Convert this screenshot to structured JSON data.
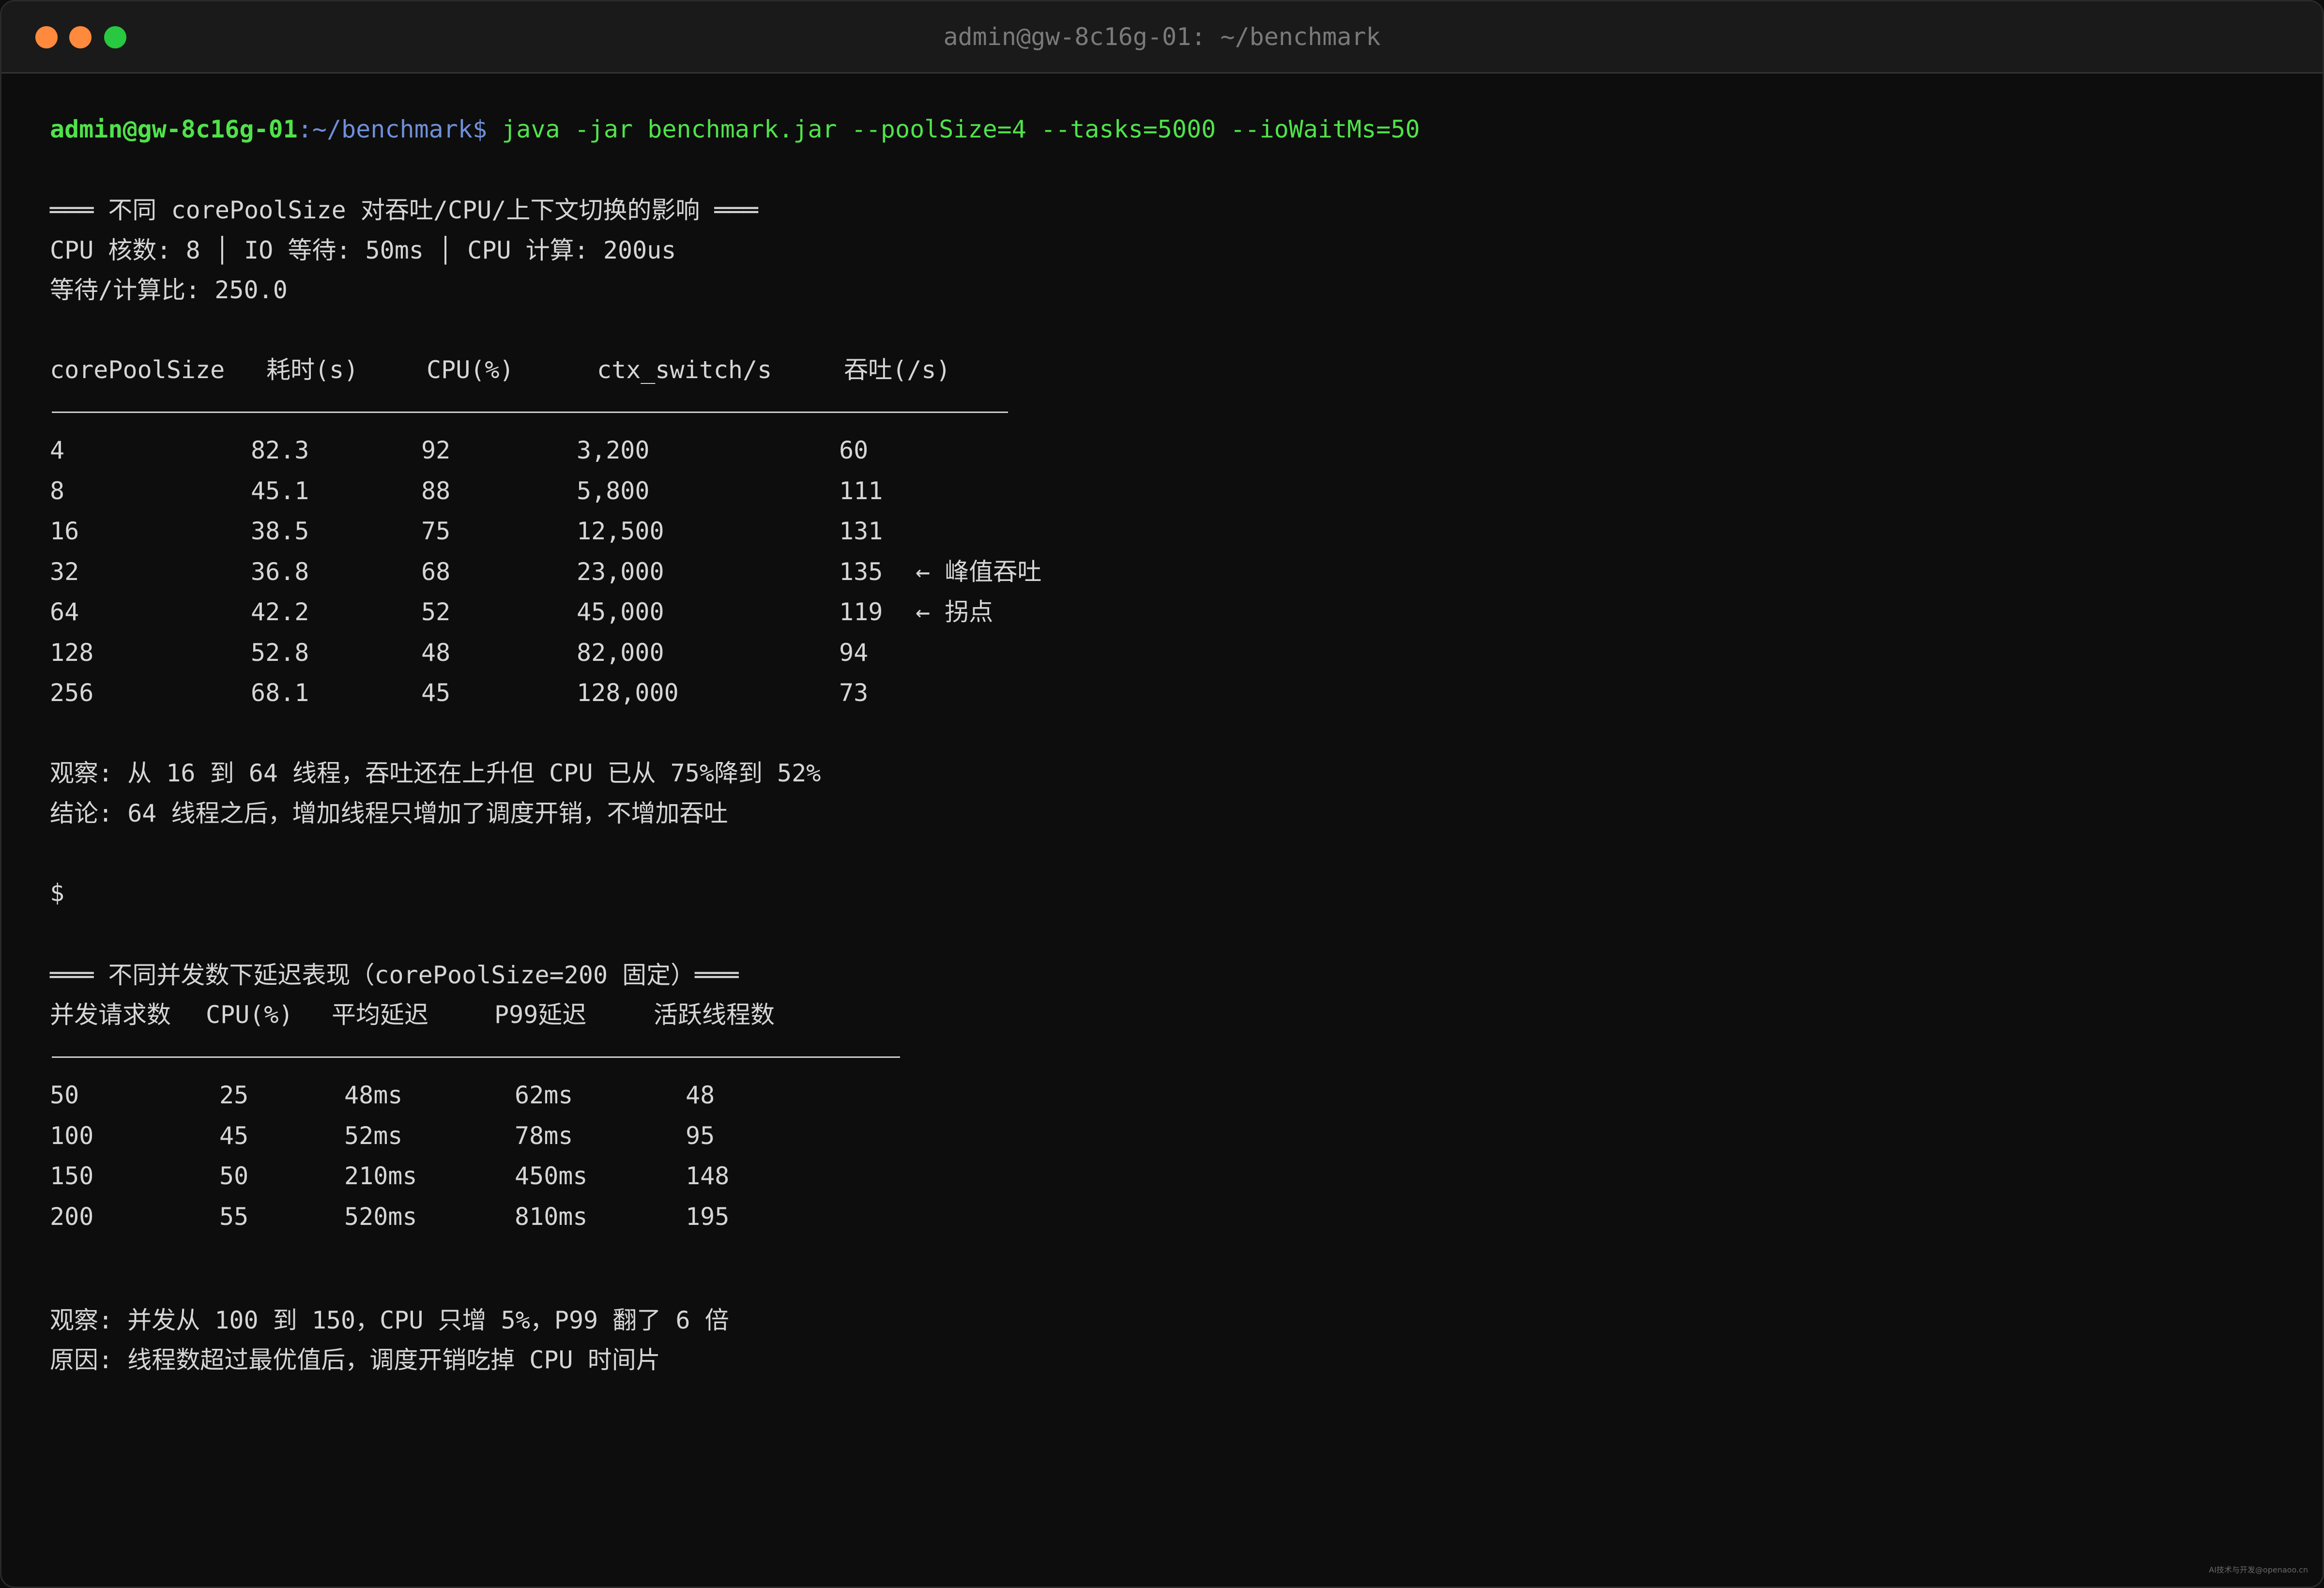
{
  "window": {
    "title": "admin@gw-8c16g-01: ~/benchmark"
  },
  "prompt": {
    "user_host": "admin@gw-8c16g-01",
    "path": ":~/benchmark$",
    "command": " java -jar benchmark.jar --poolSize=4 --tasks=5000 --ioWaitMs=50"
  },
  "section1": {
    "heading": "═══ 不同 corePoolSize 对吞吐/CPU/上下文切换的影响 ═══",
    "info_line1": "CPU 核数: 8 │ IO 等待: 50ms │ CPU 计算: 200us",
    "info_line2": "等待/计算比: 250.0",
    "columns": [
      "corePoolSize",
      "耗时(s)",
      "CPU(%)",
      "ctx_switch/s",
      "吞吐(/s)"
    ],
    "rows": [
      {
        "pool": "4",
        "time": "82.3",
        "cpu": "92",
        "ctx": "3,200",
        "tput": "60",
        "note": ""
      },
      {
        "pool": "8",
        "time": "45.1",
        "cpu": "88",
        "ctx": "5,800",
        "tput": "111",
        "note": ""
      },
      {
        "pool": "16",
        "time": "38.5",
        "cpu": "75",
        "ctx": "12,500",
        "tput": "131",
        "note": ""
      },
      {
        "pool": "32",
        "time": "36.8",
        "cpu": "68",
        "ctx": "23,000",
        "tput": "135",
        "note": "← 峰值吞吐"
      },
      {
        "pool": "64",
        "time": "42.2",
        "cpu": "52",
        "ctx": "45,000",
        "tput": "119",
        "note": "← 拐点"
      },
      {
        "pool": "128",
        "time": "52.8",
        "cpu": "48",
        "ctx": "82,000",
        "tput": "94",
        "note": ""
      },
      {
        "pool": "256",
        "time": "68.1",
        "cpu": "45",
        "ctx": "128,000",
        "tput": "73",
        "note": ""
      }
    ],
    "observation": "观察: 从 16 到 64 线程，吞吐还在上升但 CPU 已从 75%降到 52%",
    "conclusion": "结论: 64 线程之后，增加线程只增加了调度开销，不增加吞吐"
  },
  "shell_prompt": "$",
  "section2": {
    "heading": "═══ 不同并发数下延迟表现（corePoolSize=200 固定）═══",
    "columns": [
      "并发请求数",
      "CPU(%)",
      "平均延迟",
      "P99延迟",
      "活跃线程数"
    ],
    "rows": [
      {
        "conc": "50",
        "cpu": "25",
        "avg": "48ms",
        "p99": "62ms",
        "active": "48"
      },
      {
        "conc": "100",
        "cpu": "45",
        "avg": "52ms",
        "p99": "78ms",
        "active": "95"
      },
      {
        "conc": "150",
        "cpu": "50",
        "avg": "210ms",
        "p99": "450ms",
        "active": "148"
      },
      {
        "conc": "200",
        "cpu": "55",
        "avg": "520ms",
        "p99": "810ms",
        "active": "195"
      }
    ],
    "observation": "观察: 并发从 100 到 150，CPU 只增 5%，P99 翻了 6 倍",
    "reason": "原因: 线程数超过最优值后，调度开销吃掉 CPU 时间片"
  },
  "footer": {
    "mark": "AI技术与开发@openaoo.cn"
  }
}
